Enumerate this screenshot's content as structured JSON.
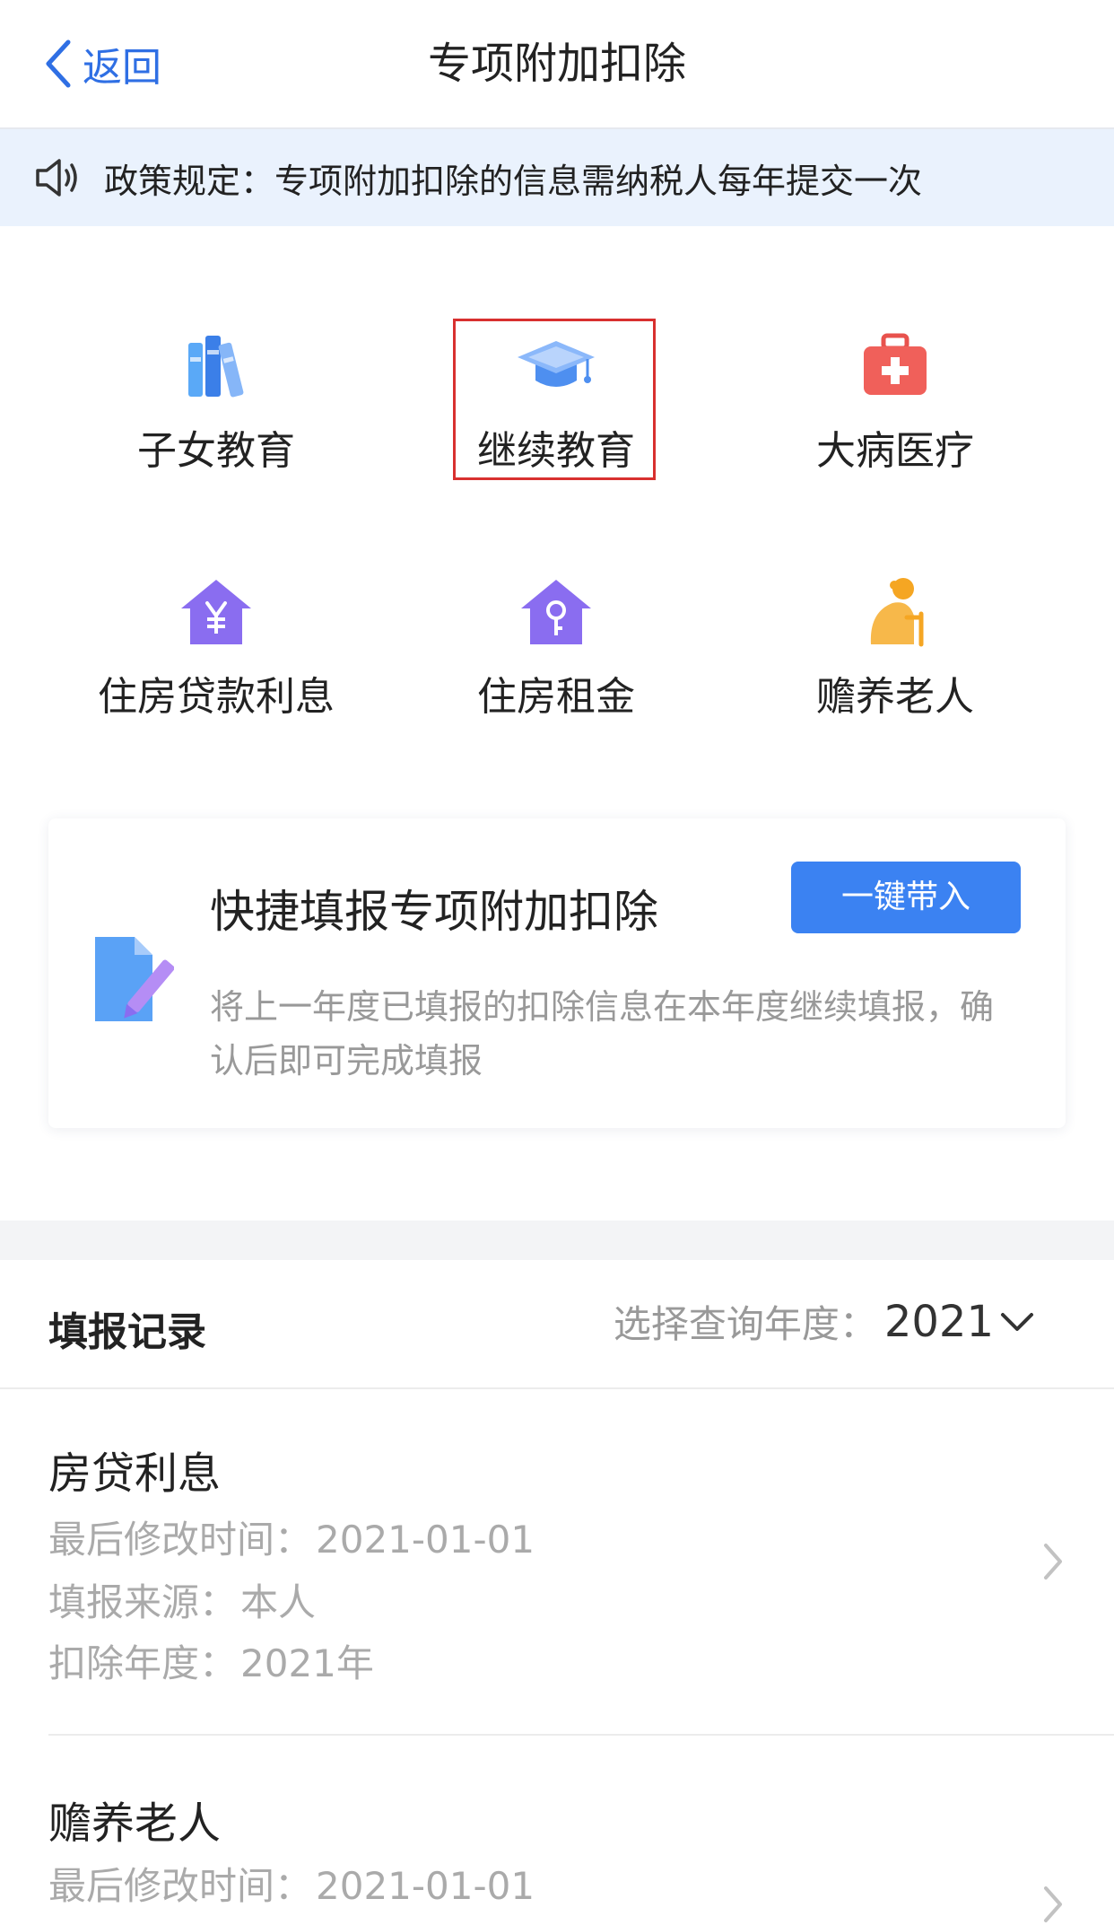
{
  "nav": {
    "back_label": "返回",
    "title": "专项附加扣除"
  },
  "notice": {
    "text": "政策规定：专项附加扣除的信息需纳税人每年提交一次"
  },
  "categories": [
    {
      "label": "子女教育",
      "icon": "books-icon"
    },
    {
      "label": "继续教育",
      "icon": "graduation-cap-icon",
      "highlighted": true
    },
    {
      "label": "大病医疗",
      "icon": "medical-kit-icon"
    },
    {
      "label": "住房贷款利息",
      "icon": "house-yuan-icon"
    },
    {
      "label": "住房租金",
      "icon": "house-key-icon"
    },
    {
      "label": "赡养老人",
      "icon": "elderly-person-icon"
    }
  ],
  "quick": {
    "title": "快捷填报专项附加扣除",
    "button": "一键带入",
    "description": "将上一年度已填报的扣除信息在本年度继续填报，确认后即可完成填报"
  },
  "records": {
    "title": "填报记录",
    "year_label": "选择查询年度：",
    "year_value": "2021",
    "items": [
      {
        "name": "房贷利息",
        "modified_label": "最后修改时间：",
        "modified_value": "2021-01-01",
        "source_label": "填报来源：",
        "source_value": "本人",
        "year_label": "扣除年度：",
        "year_value": "2021年"
      },
      {
        "name": "赡养老人",
        "modified_label": "最后修改时间：",
        "modified_value": "2021-01-01"
      }
    ]
  },
  "colors": {
    "accent": "#3b82f2",
    "highlight_border": "#d8302f",
    "notice_bg": "#eaf2fd"
  }
}
